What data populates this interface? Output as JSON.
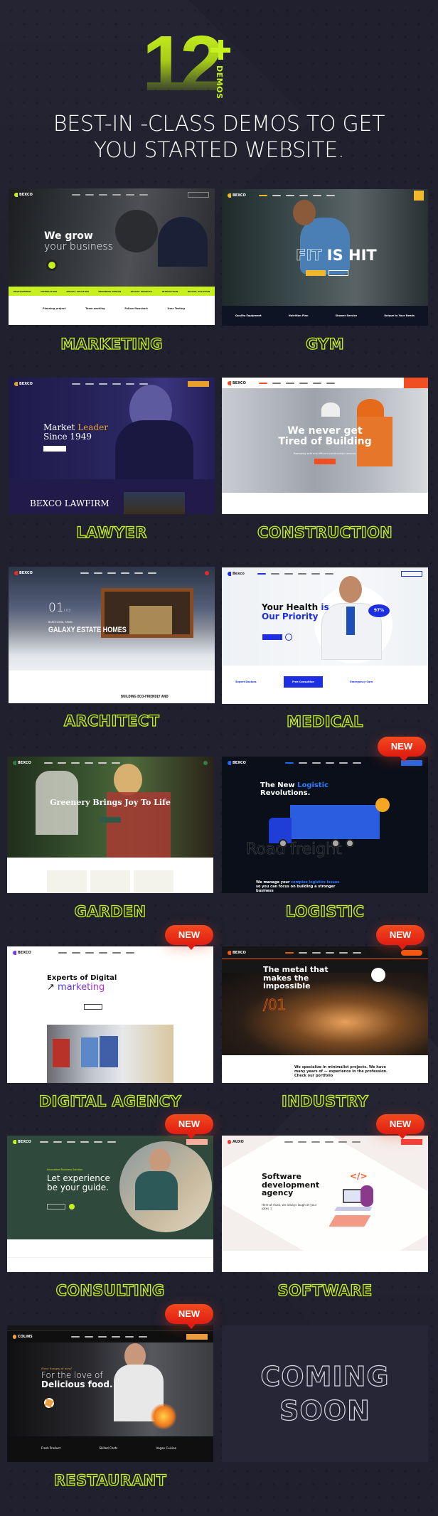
{
  "hero": {
    "count": "12",
    "plus": "+",
    "count_suffix": "DEMOS",
    "headline_line1": "BEST-IN -CLASS DEMOS TO GET",
    "headline_line2": "YOU STARTED WEBSITE."
  },
  "colors": {
    "background": "#20202f",
    "accent": "#c6f01e",
    "badge": "#e8321a"
  },
  "badge_label": "NEW",
  "demos": [
    {
      "label": "MARKETING",
      "is_new": false,
      "screen": {
        "brand": "BEXCO",
        "hero_line1": "We grow",
        "hero_line2": "your business",
        "ticker": [
          "DEVELOPMENT",
          "INTERACTION",
          "DIGITAL SOLUTION",
          "BRANDING DESIGN",
          "DIGITAL PRODUCT",
          "INTERACTION",
          "DIGITAL SOLUTION"
        ],
        "features": [
          "Planning project",
          "Team working",
          "Follow flowchart",
          "User Testing"
        ]
      }
    },
    {
      "label": "GYM",
      "is_new": false,
      "screen": {
        "brand": "BEXCO",
        "hero_outline": "FIT",
        "hero_solid": "IS HIT",
        "features": [
          "Quality Equipment",
          "Nutrition Plan",
          "Shower Service",
          "Unique to Your Needs"
        ]
      }
    },
    {
      "label": "LAWYER",
      "is_new": false,
      "screen": {
        "brand": "BEXCO",
        "hero_line1_a": "Market ",
        "hero_line1_b": "Leader",
        "hero_line2": "Since 1949",
        "footer_title": "BEXCO LAWFIRM"
      }
    },
    {
      "label": "CONSTRUCTION",
      "is_new": false,
      "screen": {
        "brand": "BEXCO",
        "hero_line1": "We never get",
        "hero_line2": "Tired of Building",
        "sub": "Promoting safe and efficient construction services."
      }
    },
    {
      "label": "ARCHITECT",
      "is_new": false,
      "screen": {
        "brand": "BEXCO",
        "slide_num": "01",
        "slide_total": "/ 03",
        "location": "BARCELONA, SPAIN",
        "hero": "GALAXY ESTATE HOMES",
        "section": "BUILDING ECO-FRIENDLY AND"
      }
    },
    {
      "label": "MEDICAL",
      "is_new": false,
      "screen": {
        "brand": "Bexco",
        "hero_line1_a": "Your Health ",
        "hero_line1_b": "is",
        "hero_line2": "Our Priority",
        "stat": "97%",
        "features": [
          "Expert Doctors",
          "Free Consultion",
          "Emergency Care",
          ""
        ]
      }
    },
    {
      "label": "GARDEN",
      "is_new": false,
      "screen": {
        "brand": "BEXCO",
        "hero": "Greenery Brings Joy To Life"
      }
    },
    {
      "label": "LOGISTIC",
      "is_new": true,
      "screen": {
        "brand": "BEXCO",
        "hero_line1_a": "The New ",
        "hero_line1_b": "Logistic",
        "hero_line2": "Revolutions.",
        "watermark": "Road freight",
        "body_a": "We manage your ",
        "body_b": "complex logistics issues",
        "body_c": " so you can focus on building a stronger business"
      }
    },
    {
      "label": "DIGITAL AGENCY",
      "is_new": true,
      "screen": {
        "brand": "BEXCO",
        "hero_line1": "Experts of Digital",
        "hero_line2": "marketing"
      }
    },
    {
      "label": "INDUSTRY",
      "is_new": true,
      "screen": {
        "brand": "BEXCO",
        "hero_line1": "The metal that",
        "hero_line2": "makes the",
        "hero_line3": "impossible",
        "slide_num": "/01",
        "body": "We specialize in minimalist projects. We have many years of — experience in the profession. Check our portfolio"
      }
    },
    {
      "label": "CONSULTING",
      "is_new": true,
      "screen": {
        "brand": "BEXCO",
        "kicker": "Innovative Business Solution",
        "hero_line1": "Let experience",
        "hero_line2": "be your guide."
      }
    },
    {
      "label": "SOFTWARE",
      "is_new": true,
      "screen": {
        "brand": "AUXO",
        "hero_line1": "Software",
        "hero_line2": "development",
        "hero_line3": "agency",
        "sub": "Here at Auxo, we always laugh at your jokes :)"
      }
    },
    {
      "label": "RESTAURANT",
      "is_new": true,
      "screen": {
        "brand": "COLINS",
        "kicker": "Have hungry at meal",
        "hero_line1": "For the love of",
        "hero_line2": "Delicious food.",
        "features": [
          "Fresh Product",
          "Skilled Chefs",
          "Vegan Cuisine"
        ]
      }
    }
  ],
  "coming_soon": {
    "line1": "COMING",
    "line2": "SOON"
  }
}
